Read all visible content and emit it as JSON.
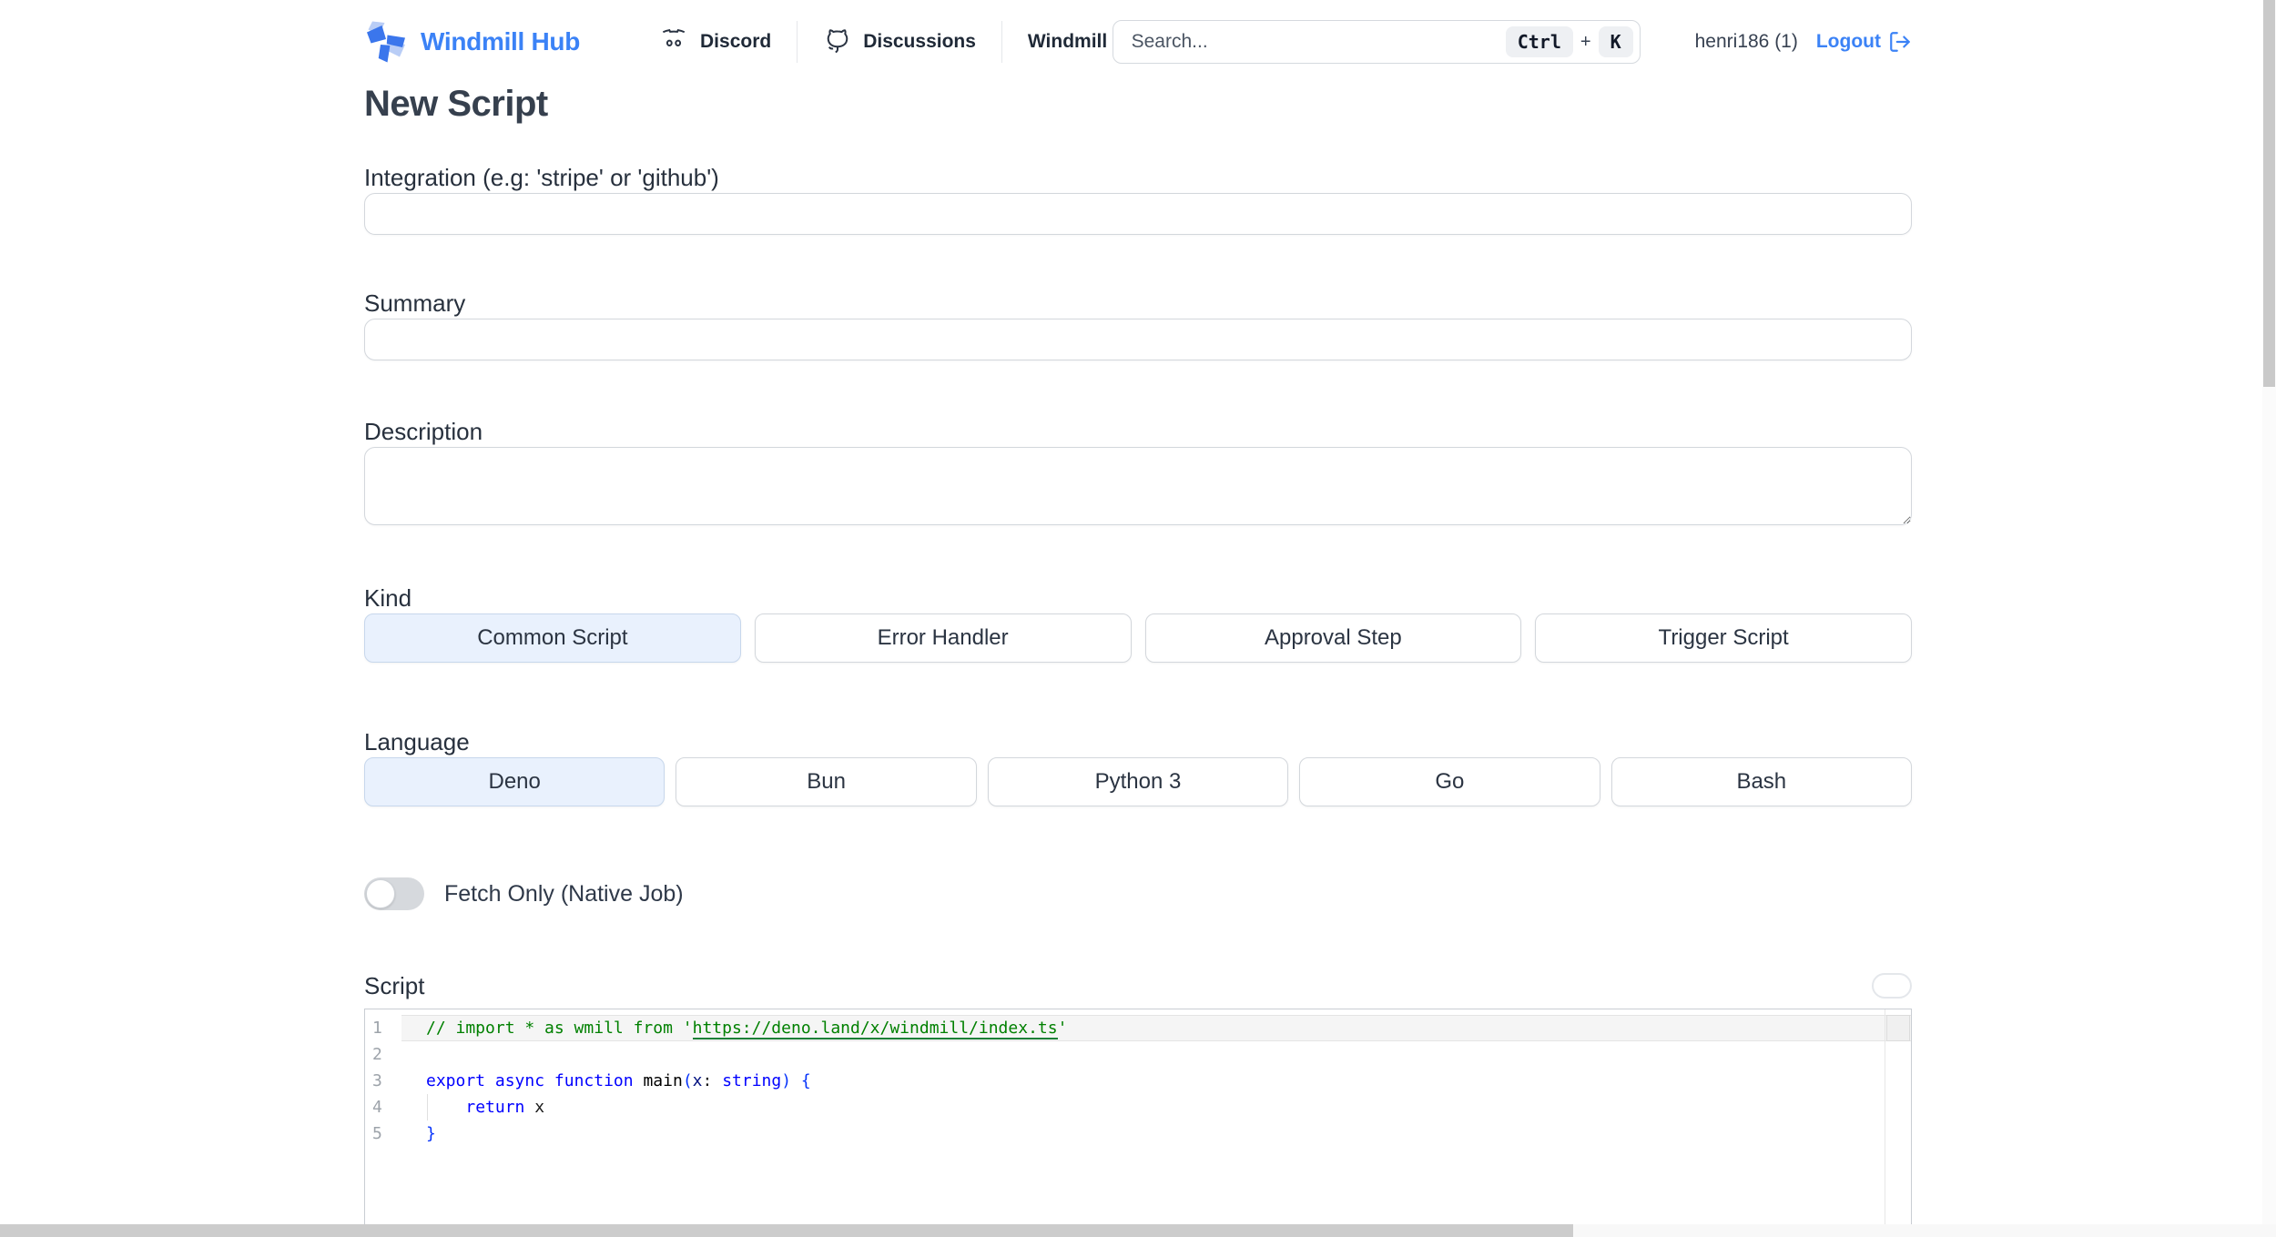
{
  "header": {
    "brand": "Windmill Hub",
    "nav": [
      {
        "label": "Discord",
        "icon": "discord-icon"
      },
      {
        "label": "Discussions",
        "icon": "github-discussions-icon"
      },
      {
        "label": "Windmill",
        "icon": null
      }
    ],
    "search": {
      "placeholder": "Search...",
      "kbd_ctrl": "Ctrl",
      "kbd_plus": "+",
      "kbd_k": "K"
    },
    "user": "henri186 (1)",
    "logout_label": "Logout"
  },
  "page": {
    "title": "New Script",
    "fields": {
      "integration": {
        "label": "Integration (e.g: 'stripe' or 'github')",
        "value": ""
      },
      "summary": {
        "label": "Summary",
        "value": ""
      },
      "description": {
        "label": "Description",
        "value": ""
      }
    },
    "kind": {
      "label": "Kind",
      "options": [
        "Common Script",
        "Error Handler",
        "Approval Step",
        "Trigger Script"
      ],
      "selected": "Common Script"
    },
    "language": {
      "label": "Language",
      "options": [
        "Deno",
        "Bun",
        "Python 3",
        "Go",
        "Bash"
      ],
      "selected": "Deno"
    },
    "fetch_only": {
      "label": "Fetch Only (Native Job)",
      "enabled": false
    },
    "script": {
      "label": "Script",
      "lines": [
        {
          "num": "1",
          "tokens": [
            {
              "t": "// import * as wmill from '",
              "c": "comment"
            },
            {
              "t": "https://deno.land/x/windmill/index.ts",
              "c": "comment",
              "u": true
            },
            {
              "t": "'",
              "c": "comment"
            }
          ]
        },
        {
          "num": "2",
          "tokens": []
        },
        {
          "num": "3",
          "tokens": [
            {
              "t": "export",
              "c": "kw"
            },
            {
              "t": " ",
              "c": "plain"
            },
            {
              "t": "async",
              "c": "kw"
            },
            {
              "t": " ",
              "c": "plain"
            },
            {
              "t": "function",
              "c": "kw"
            },
            {
              "t": " ",
              "c": "plain"
            },
            {
              "t": "main",
              "c": "fn"
            },
            {
              "t": "(",
              "c": "bracket"
            },
            {
              "t": "x",
              "c": "param"
            },
            {
              "t": ": ",
              "c": "plain"
            },
            {
              "t": "string",
              "c": "kw"
            },
            {
              "t": ")",
              "c": "bracket"
            },
            {
              "t": " ",
              "c": "plain"
            },
            {
              "t": "{",
              "c": "bracket"
            }
          ]
        },
        {
          "num": "4",
          "tokens": [
            {
              "t": "    ",
              "c": "plain"
            },
            {
              "t": "return",
              "c": "kw"
            },
            {
              "t": " x",
              "c": "plain"
            }
          ]
        },
        {
          "num": "5",
          "tokens": [
            {
              "t": "}",
              "c": "bracket"
            }
          ]
        }
      ]
    }
  },
  "colors": {
    "brand_blue": "#3b82f6",
    "selected_option_bg": "#e9f1fd",
    "comment_green": "#008000",
    "keyword_blue": "#0000ff",
    "title_text": "#36404e"
  }
}
